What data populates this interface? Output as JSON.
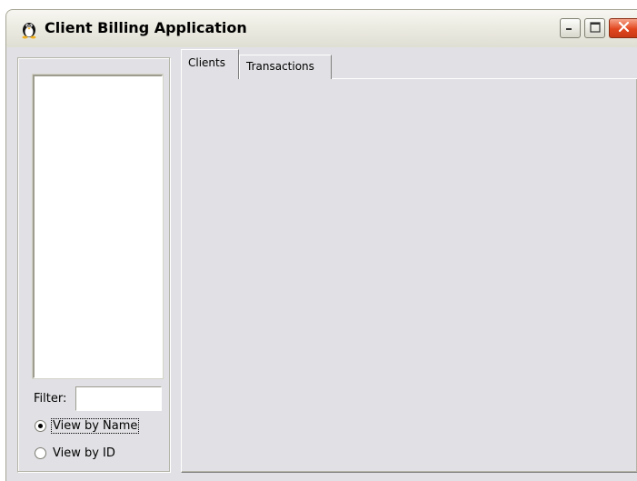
{
  "window": {
    "title": "Client Billing Application",
    "icon": "tux-penguin-icon",
    "controls": {
      "minimize": "minimize-icon",
      "maximize": "maximize-icon",
      "close": "close-icon"
    },
    "accent_close": "#e1461e"
  },
  "sidebar": {
    "filter_label": "Filter:",
    "filter_value": "",
    "view_options": [
      {
        "label": "View by Name",
        "checked": true
      },
      {
        "label": "View by ID",
        "checked": false
      }
    ]
  },
  "tabs": [
    {
      "label": "Clients",
      "active": true
    },
    {
      "label": "Transactions",
      "active": false
    }
  ]
}
